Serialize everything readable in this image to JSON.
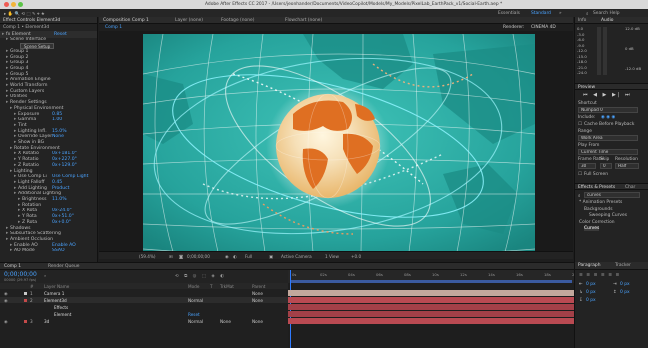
{
  "app": {
    "title": "Adobe After Effects CC 2017 - /Users/jeonhander/Documents/VideoCopilot/Models/My_Models/PixelLab_EarthPack_v1/Social-Earth.aep *"
  },
  "workspaces": {
    "items": [
      "Essentials",
      "Standard"
    ],
    "active": "Standard",
    "search": "Search Help"
  },
  "effect_controls": {
    "header": "Effect Controls Element3d",
    "layer_path": "Comp 1 • Element3d",
    "rows": [
      {
        "indent": 0,
        "label": "fx  Element",
        "value": ""
      },
      {
        "indent": 1,
        "label": "Scene Interface",
        "value": ""
      },
      {
        "indent": 2,
        "label": "",
        "value": "",
        "button": "Scene Setup"
      },
      {
        "indent": 1,
        "label": "Group 1",
        "value": ""
      },
      {
        "indent": 1,
        "label": "Group 2",
        "value": ""
      },
      {
        "indent": 1,
        "label": "Group 3",
        "value": ""
      },
      {
        "indent": 1,
        "label": "Group 4",
        "value": ""
      },
      {
        "indent": 1,
        "label": "Group 5",
        "value": ""
      },
      {
        "indent": 1,
        "label": "Animation Engine",
        "value": ""
      },
      {
        "indent": 1,
        "label": "World Transform",
        "value": ""
      },
      {
        "indent": 1,
        "label": "Custom Layers",
        "value": ""
      },
      {
        "indent": 1,
        "label": "Utilities",
        "value": ""
      },
      {
        "indent": 1,
        "label": "Render Settings",
        "value": ""
      },
      {
        "indent": 2,
        "label": "Physical Environment",
        "value": ""
      },
      {
        "indent": 3,
        "label": "Exposure",
        "value": "0.85"
      },
      {
        "indent": 3,
        "label": "Gamma",
        "value": "1.00"
      },
      {
        "indent": 3,
        "label": "Tint",
        "value": ""
      },
      {
        "indent": 3,
        "label": "Lighting Infl.",
        "value": "15.0%"
      },
      {
        "indent": 3,
        "label": "Override Layer",
        "value": "None"
      },
      {
        "indent": 3,
        "label": "Show in BG",
        "value": ""
      },
      {
        "indent": 2,
        "label": "Rotate Environment",
        "value": ""
      },
      {
        "indent": 3,
        "label": "X Rotatio",
        "value": "0x+181.0°"
      },
      {
        "indent": 3,
        "label": "Y Rotatio",
        "value": "0x+227.0°"
      },
      {
        "indent": 3,
        "label": "Z Rotatio",
        "value": "0x+129.0°"
      },
      {
        "indent": 2,
        "label": "Lighting",
        "value": ""
      },
      {
        "indent": 3,
        "label": "Use Comp Li",
        "value": "Use Comp Light"
      },
      {
        "indent": 3,
        "label": "Light Falloff",
        "value": "0.45"
      },
      {
        "indent": 3,
        "label": "Add Lighting",
        "value": "Product"
      },
      {
        "indent": 3,
        "label": "Additional Lighting",
        "value": ""
      },
      {
        "indent": 4,
        "label": "Brightness",
        "value": "11.0%"
      },
      {
        "indent": 4,
        "label": "Rotation",
        "value": ""
      },
      {
        "indent": 4,
        "label": "X Rota",
        "value": "0x-24.0°"
      },
      {
        "indent": 4,
        "label": "Y Rota",
        "value": "0x+51.0°"
      },
      {
        "indent": 4,
        "label": "Z Rota",
        "value": "0x+0.0°"
      },
      {
        "indent": 1,
        "label": "Shadows",
        "value": ""
      },
      {
        "indent": 1,
        "label": "Subsurface Scattering",
        "value": ""
      },
      {
        "indent": 1,
        "label": "Ambient Occlusion",
        "value": ""
      },
      {
        "indent": 2,
        "label": "Enable AO",
        "value": "Enable AO"
      },
      {
        "indent": 2,
        "label": "AO Mode",
        "value": "SSAO"
      }
    ],
    "reset_label": "Reset"
  },
  "composition": {
    "tabs": [
      {
        "label": "Composition Comp 1"
      },
      {
        "label": "Layer (none)"
      },
      {
        "label": "Footage (none)"
      },
      {
        "label": "Flowchart (none)"
      }
    ],
    "sub_tab": "Comp 1",
    "renderer_label": "Renderer:",
    "renderer_value": "CINEMA 4D",
    "viewer_bar": {
      "zoom": "(59.4%)",
      "timecode": "0;00;00;00",
      "resolution": "Full",
      "camera": "Active Camera",
      "views": "1 View",
      "exposure": "+0.0"
    }
  },
  "right_panel": {
    "tabs": [
      "Info",
      "Audio"
    ],
    "audio_scale": [
      "0.0",
      "-3.0",
      "-6.0",
      "-9.0",
      "-12.0",
      "-15.0",
      "-18.0",
      "-21.0",
      "-24.0"
    ],
    "audio_values_right": [
      "12.0 dB",
      "0 dB",
      "-12.0 dB"
    ],
    "preview": {
      "title": "Preview",
      "shortcut_label": "Shortcut",
      "shortcut_value": "Numpad 0",
      "include_label": "Include:",
      "cache_label": "Cache Before Playback",
      "range_label": "Range",
      "range_value": "Work Area",
      "play_from_label": "Play From",
      "play_from_value": "Current Time",
      "frame_rate_label": "Frame Rate",
      "skip_label": "Skip",
      "resolution_label": "Resolution",
      "frame_rate_value": "30",
      "skip_value": "0",
      "resolution_value": "Half",
      "full_screen_label": "Full Screen"
    },
    "effects": {
      "tabs": [
        "Effects & Presets",
        "Char"
      ],
      "search_value": "curves",
      "items": [
        {
          "indent": 0,
          "label": "* Animation Presets"
        },
        {
          "indent": 1,
          "label": "Backgrounds"
        },
        {
          "indent": 2,
          "label": "Sweeping Curves"
        },
        {
          "indent": 0,
          "label": "Color Correction"
        },
        {
          "indent": 1,
          "label": "Curves"
        }
      ]
    }
  },
  "timeline": {
    "tabs": [
      {
        "label": "Comp 1"
      },
      {
        "label": "Render Queue"
      }
    ],
    "timecode": "0;00;00;00",
    "fps_note": "00000 (29.97 fps)",
    "columns": [
      "#",
      "Layer Name",
      "Mode",
      "T",
      "TrkMat",
      "Parent"
    ],
    "layers": [
      {
        "num": "1",
        "name": "Camera 1",
        "mode": "",
        "trkmat": "",
        "parent": "None",
        "color": "#c8c8c8"
      },
      {
        "num": "2",
        "name": "Element3d",
        "mode": "Normal",
        "trkmat": "",
        "parent": "None",
        "color": "#c44a4a"
      },
      {
        "num": "",
        "name": "Effects",
        "mode": "",
        "trkmat": "",
        "parent": "",
        "color": ""
      },
      {
        "num": "",
        "name": "Element",
        "mode": "Reset",
        "trkmat": "",
        "parent": "",
        "color": ""
      },
      {
        "num": "3",
        "name": "3d",
        "mode": "Normal",
        "trkmat": "None",
        "parent": "None",
        "color": "#c44a4a"
      }
    ],
    "ruler": [
      "0s",
      "02s",
      "04s",
      "06s",
      "08s",
      "10s",
      "12s",
      "14s",
      "16s",
      "18s",
      "20s"
    ],
    "colors": {
      "camera_bar": "#c2a89c",
      "layer_bar": "#b94a52",
      "work_area": "#3a5aa0",
      "playhead": "#2f7bff"
    }
  },
  "paragraph_panel": {
    "tabs": [
      "Paragraph",
      "Tracker"
    ],
    "values": [
      "0 px",
      "0 px",
      "0 px",
      "0 px",
      "0 px"
    ]
  },
  "colors": {
    "accent": "#4aa3ff",
    "scene_teal": "#2aa7a0",
    "globe_orange": "#e07a2a"
  }
}
